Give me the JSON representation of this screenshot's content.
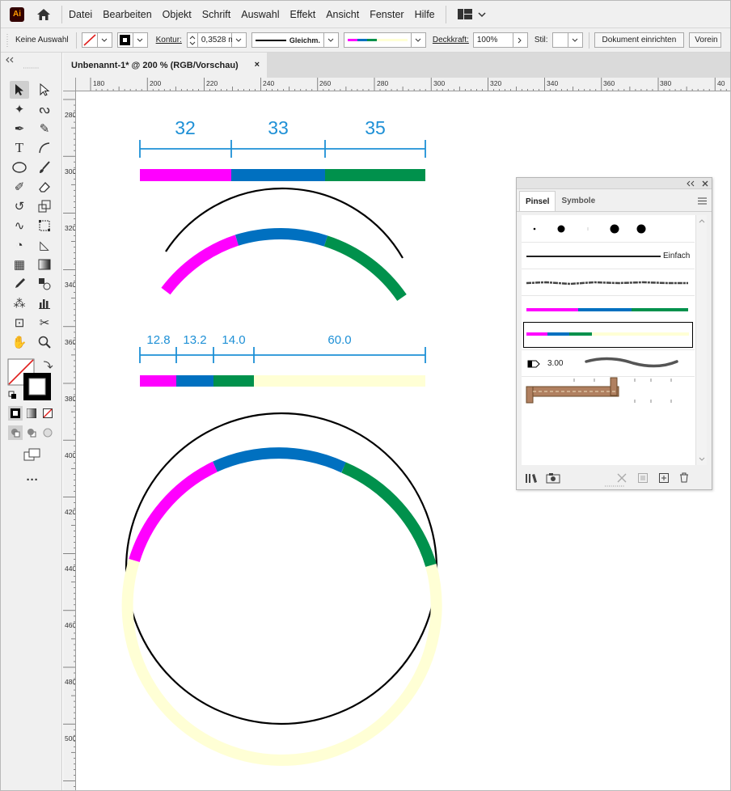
{
  "app": {
    "logo": "Ai",
    "menu": [
      "Datei",
      "Bearbeiten",
      "Objekt",
      "Schrift",
      "Auswahl",
      "Effekt",
      "Ansicht",
      "Fenster",
      "Hilfe"
    ]
  },
  "control_bar": {
    "selection": "Keine Auswahl",
    "stroke_label": "Kontur:",
    "stroke_value": "0,3528 m",
    "profile_label": "Gleichm.",
    "opacity_label": "Deckkraft:",
    "opacity_value": "100%",
    "style_label": "Stil:",
    "setup_button": "Dokument einrichten",
    "prefs_button": "Vorein"
  },
  "document": {
    "tab_title": "Unbenannt-1* @ 200 % (RGB/Vorschau)",
    "close": "×"
  },
  "ruler": {
    "h_labels": [
      "180",
      "200",
      "220",
      "240",
      "260",
      "280",
      "300",
      "320",
      "340",
      "360",
      "380",
      "40"
    ],
    "v_labels": [
      "280",
      "300",
      "320",
      "340",
      "360",
      "380",
      "400",
      "420",
      "440",
      "460",
      "480",
      "500"
    ]
  },
  "artwork": {
    "top_segments": [
      "32",
      "33",
      "35"
    ],
    "bottom_segments": [
      "12.8",
      "13.2",
      "14.0",
      "60.0"
    ],
    "colors": {
      "magenta": "#ff00ff",
      "blue": "#0070c0",
      "green": "#00914c",
      "cream": "#ffffd5",
      "dimension": "#1e90d6"
    }
  },
  "brush_panel": {
    "tabs": [
      "Pinsel",
      "Symbole"
    ],
    "active_tab": "Pinsel",
    "basic_brush_label": "Einfach",
    "calligraphic_size": "3.00"
  }
}
